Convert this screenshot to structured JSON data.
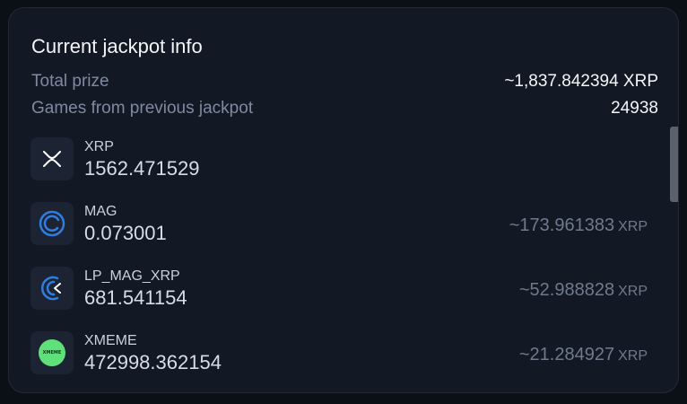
{
  "title": "Current jackpot info",
  "summary": {
    "total_prize_label": "Total prize",
    "total_prize_value": "~1,837.842394 XRP",
    "games_label": "Games from previous jackpot",
    "games_value": "24938"
  },
  "tokens": [
    {
      "symbol": "XRP",
      "amount": "1562.471529",
      "converted": "",
      "unit": "",
      "icon": "xrp-icon"
    },
    {
      "symbol": "MAG",
      "amount": "0.073001",
      "converted": "~173.961383",
      "unit": "XRP",
      "icon": "mag-icon"
    },
    {
      "symbol": "LP_MAG_XRP",
      "amount": "681.541154",
      "converted": "~52.988828",
      "unit": "XRP",
      "icon": "lp-mag-xrp-icon"
    },
    {
      "symbol": "XMEME",
      "amount": "472998.362154",
      "converted": "~21.284927",
      "unit": "XRP",
      "icon": "xmeme-icon",
      "icon_text": "XMEME"
    }
  ],
  "colors": {
    "background": "#0b0f16",
    "card": "#131924",
    "accent_blue": "#2f7de1",
    "xmeme_green": "#5fe07a"
  }
}
